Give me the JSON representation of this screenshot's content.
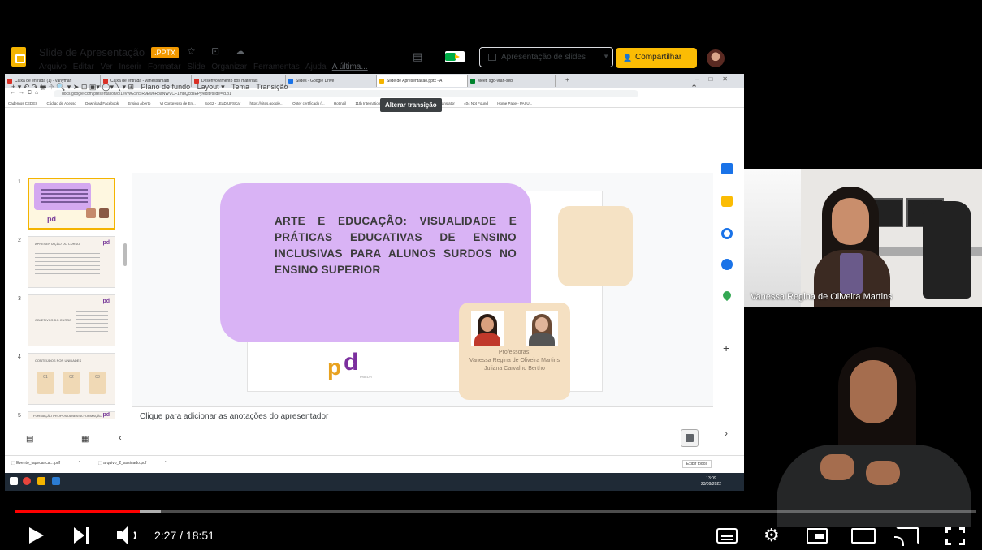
{
  "browser": {
    "tabs": [
      {
        "label": "Caixa de entrada (1) - vanymari",
        "color": "#d93025"
      },
      {
        "label": "Caixa de entrada - vanessamarti",
        "color": "#d93025"
      },
      {
        "label": "Desenvolvimento dos materiais",
        "color": "#d93025"
      },
      {
        "label": "Slides - Google Drive",
        "color": "#1a73e8"
      },
      {
        "label": "Slide de Apresentação.pptx - A",
        "color": "#f4b400"
      },
      {
        "label": "Meet: sgq-vran-seb",
        "color": "#00832d"
      }
    ],
    "url": "docs.google.com/presentation/d/1evWGSnSR9Ew6RoaNWVCF1mbQcdJEPy/edit#slide=id.p1",
    "bookmarks": [
      "Cadernos CEDES",
      "Código de Acesso",
      "Download Facebook",
      "Ensino Aberto",
      "VI Congresso de En...",
      "SoG2 - 1EaD/UFSCar",
      "https://sites.google...",
      "Obter certificado (...",
      "Hotmail",
      "11th International...",
      "Faça o download d...",
      "Translator",
      "404 Not Found",
      "Home Page - PAI-U..."
    ]
  },
  "docs": {
    "title": "Slide de Apresentação",
    "badge": ".PPTX",
    "title_icons": "☆ ⊡ ☁",
    "menu": [
      "Arquivo",
      "Editar",
      "Ver",
      "Inserir",
      "Formatar",
      "Slide",
      "Organizar",
      "Ferramentas",
      "Ajuda"
    ],
    "last_edit": "A última...",
    "present_label": "Apresentação de slides",
    "share_label": "Compartilhar",
    "toolbar": {
      "icons": "+ ▾ ↶ ↷ 🖶 ⌖  🔍 ▾  ➤ ⊡ ▣▾ ◯▾ ╲ ▾  ⊞",
      "background": "Plano de fundo",
      "layout": "Layout ▾",
      "theme": "Tema",
      "transition": "Transição"
    },
    "tooltip": "Alterar transição",
    "notes_placeholder": "Clique para adicionar as anotações do apresentador",
    "slide_numbers": [
      "1",
      "2",
      "3",
      "4",
      "5"
    ],
    "thumbs": {
      "t2": "APRESENTAÇÃO DO CURSO",
      "t3": "OBJETIVOS DO CURSO",
      "t4": "CONTEÚDOS POR UNIDADES",
      "t5": "FORMAÇÃO PROPOSTA NESSA FORMAÇÃO",
      "boxes": [
        "01",
        "02",
        "03"
      ],
      "logo": "pd"
    }
  },
  "slide": {
    "title": "ARTE E EDUCAÇÃO: VISUALIDADE E PRÁTICAS EDUCATIVAS DE ENSINO INCLUSIVAS PARA ALUNOS SURDOS NO ENSINO SUPERIOR",
    "professors_label": "Professoras:",
    "professor_1": "Vanessa Regina de Oliveira Martins",
    "professor_2": "Juliana Carvalho Bertho",
    "logo_p": "p",
    "logo_d": "d",
    "logo_caption": "ProEDH"
  },
  "downloads": {
    "file1": "Evento_tapecarica....pdf",
    "file2": "arquivo_2_assinado.pdf",
    "show_all": "Exibir todos"
  },
  "taskbar": {
    "time": "13:09",
    "date": "23/09/2022"
  },
  "webcam": {
    "name": "Vanessa Regina de Oliveira Martins"
  },
  "player": {
    "time_display": "2:27 / 18:51",
    "progress_fraction": 0.13
  }
}
